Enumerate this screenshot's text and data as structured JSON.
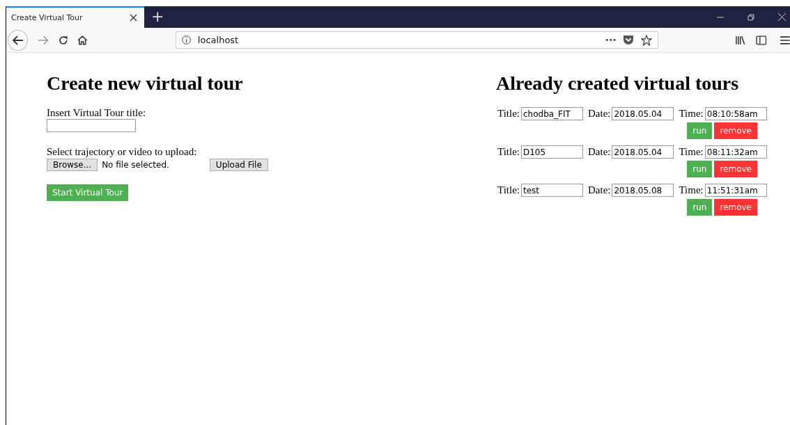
{
  "browser": {
    "tab_title": "Create Virtual Tour",
    "new_tab": "+",
    "url": "localhost",
    "page_actions": "•••"
  },
  "create": {
    "heading": "Create new virtual tour",
    "title_label": "Insert Virtual Tour title:",
    "upload_label": "Select trajectory or video to upload:",
    "browse_button": "Browse...",
    "file_status": "No file selected.",
    "upload_button": "Upload File",
    "start_button": "Start Virtual Tour"
  },
  "created": {
    "heading": "Already created virtual tours",
    "tours": [
      {
        "title_label": "Title:",
        "title": "chodba_FIT",
        "date_label": "Date:",
        "date": "2018.05.04",
        "time_label": "Time:",
        "time": "08:10:58am",
        "run_button": "run",
        "remove_button": "remove"
      },
      {
        "title_label": "Title:",
        "title": "D105",
        "date_label": "Date:",
        "date": "2018.05.04",
        "time_label": "Time:",
        "time": "08:11:32am",
        "run_button": "run",
        "remove_button": "remove"
      },
      {
        "title_label": "Title:",
        "title": "test",
        "date_label": "Date:",
        "date": "2018.05.08",
        "time_label": "Time:",
        "time": "11:51:31am",
        "run_button": "run",
        "remove_button": "remove"
      }
    ]
  }
}
